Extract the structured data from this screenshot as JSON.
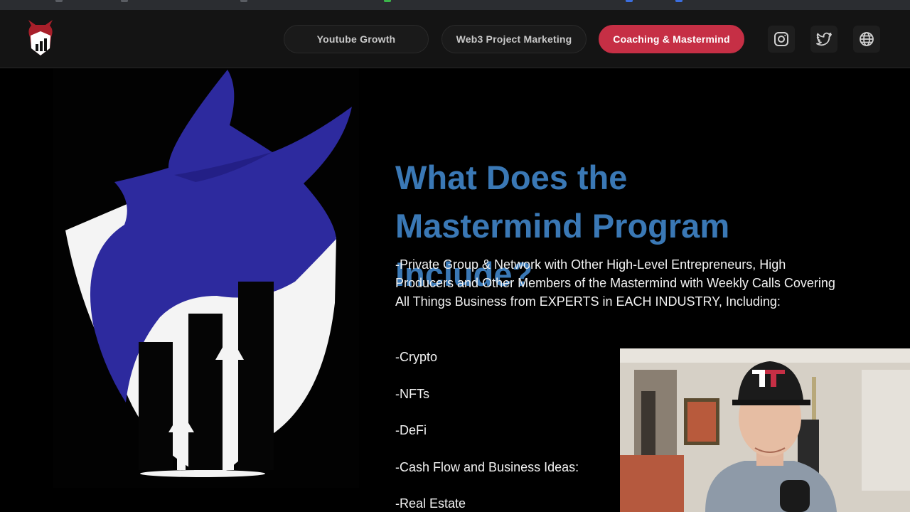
{
  "nav": {
    "buttons": [
      {
        "label": "Youtube Growth",
        "active": false
      },
      {
        "label": "Web3 Project Marketing",
        "active": false
      },
      {
        "label": "Coaching & Mastermind",
        "active": true
      }
    ],
    "icons": [
      "instagram-icon",
      "twitter-icon",
      "globe-icon"
    ]
  },
  "content": {
    "heading_lines": [
      "What Does the",
      "Mastermind Program",
      "Include?"
    ],
    "body": "-Private Group & Network with Other High-Level Entrepreneurs, High Producers and Other Members of the Mastermind with Weekly Calls Covering All Things Business from EXPERTS in EACH INDUSTRY, Including:",
    "items": [
      "-Crypto",
      "-NFTs",
      "-DeFi",
      "-Cash Flow and Business Ideas:",
      "-Real Estate"
    ]
  },
  "colors": {
    "accent": "#c62f45",
    "heading": "#3a78b5",
    "logo_blue": "#2d2a9e"
  }
}
